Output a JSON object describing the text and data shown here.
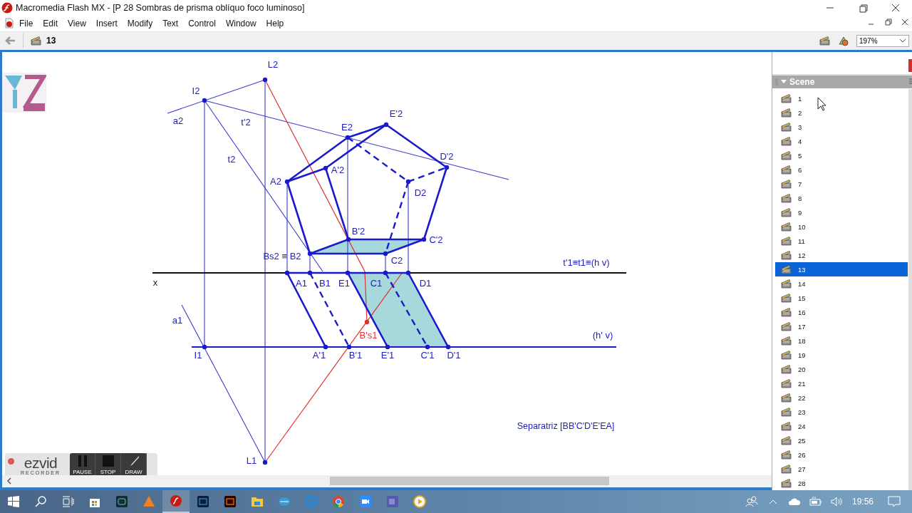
{
  "window": {
    "title": "Macromedia Flash MX - [P 28 Sombras de prisma oblíquo foco luminoso]"
  },
  "menu": [
    "File",
    "Edit",
    "View",
    "Insert",
    "Modify",
    "Text",
    "Control",
    "Window",
    "Help"
  ],
  "edit_bar": {
    "scene": "13",
    "zoom": "197%"
  },
  "stage": {
    "labels": [
      {
        "text": "L2",
        "color": "#2020c0"
      },
      {
        "text": "I2",
        "color": "#2020c0"
      },
      {
        "text": "a2",
        "color": "#2020c0"
      },
      {
        "text": "t'2",
        "color": "#2020c0"
      },
      {
        "text": "t2",
        "color": "#2020c0"
      },
      {
        "text": "E2",
        "color": "#2020c0"
      },
      {
        "text": "E'2",
        "color": "#2020c0"
      },
      {
        "text": "D'2",
        "color": "#2020c0"
      },
      {
        "text": "A'2",
        "color": "#2020c0"
      },
      {
        "text": "A2",
        "color": "#2020c0"
      },
      {
        "text": "D2",
        "color": "#2020c0"
      },
      {
        "text": "B'2",
        "color": "#2020c0"
      },
      {
        "text": "C'2",
        "color": "#2020c0"
      },
      {
        "text": "Bs2 ≡ B2",
        "color": "#2020c0"
      },
      {
        "text": "C2",
        "color": "#2020c0"
      },
      {
        "text": "t'1≡t1≡(h v)",
        "color": "#2020c0"
      },
      {
        "text": "A1",
        "color": "#2020c0"
      },
      {
        "text": "B1",
        "color": "#2020c0"
      },
      {
        "text": "E1",
        "color": "#2020c0"
      },
      {
        "text": "C1",
        "color": "#2020c0"
      },
      {
        "text": "D1",
        "color": "#2020c0"
      },
      {
        "text": "a1",
        "color": "#2020c0"
      },
      {
        "text": "(h' v)",
        "color": "#2020c0"
      },
      {
        "text": "B's1",
        "color": "#e03030"
      },
      {
        "text": "I1",
        "color": "#2020c0"
      },
      {
        "text": "A'1",
        "color": "#2020c0"
      },
      {
        "text": "B'1",
        "color": "#2020c0"
      },
      {
        "text": "E'1",
        "color": "#2020c0"
      },
      {
        "text": "C'1",
        "color": "#2020c0"
      },
      {
        "text": "D'1",
        "color": "#2020c0"
      },
      {
        "text": "L1",
        "color": "#2020c0"
      }
    ],
    "axis_label": "x",
    "caption": "Separatriz [BB'C'D'E'EA]"
  },
  "recorder": {
    "logo": "ezvid",
    "subtitle": "RECORDER",
    "buttons": [
      "PAUSE",
      "STOP",
      "DRAW"
    ]
  },
  "scene_panel": {
    "title": "Scene",
    "scenes": [
      {
        "label": "1",
        "selected": false
      },
      {
        "label": "2",
        "selected": false
      },
      {
        "label": "3",
        "selected": false
      },
      {
        "label": "4",
        "selected": false
      },
      {
        "label": "5",
        "selected": false
      },
      {
        "label": "6",
        "selected": false
      },
      {
        "label": "7",
        "selected": false
      },
      {
        "label": "8",
        "selected": false
      },
      {
        "label": "9",
        "selected": false
      },
      {
        "label": "10",
        "selected": false
      },
      {
        "label": "11",
        "selected": false
      },
      {
        "label": "12",
        "selected": false
      },
      {
        "label": "13",
        "selected": true
      },
      {
        "label": "14",
        "selected": false
      },
      {
        "label": "15",
        "selected": false
      },
      {
        "label": "16",
        "selected": false
      },
      {
        "label": "17",
        "selected": false
      },
      {
        "label": "18",
        "selected": false
      },
      {
        "label": "19",
        "selected": false
      },
      {
        "label": "20",
        "selected": false
      },
      {
        "label": "21",
        "selected": false
      },
      {
        "label": "22",
        "selected": false
      },
      {
        "label": "23",
        "selected": false
      },
      {
        "label": "24",
        "selected": false
      },
      {
        "label": "25",
        "selected": false
      },
      {
        "label": "26",
        "selected": false
      },
      {
        "label": "27",
        "selected": false
      },
      {
        "label": "28",
        "selected": false
      }
    ]
  },
  "taskbar": {
    "clock": "19:56"
  }
}
